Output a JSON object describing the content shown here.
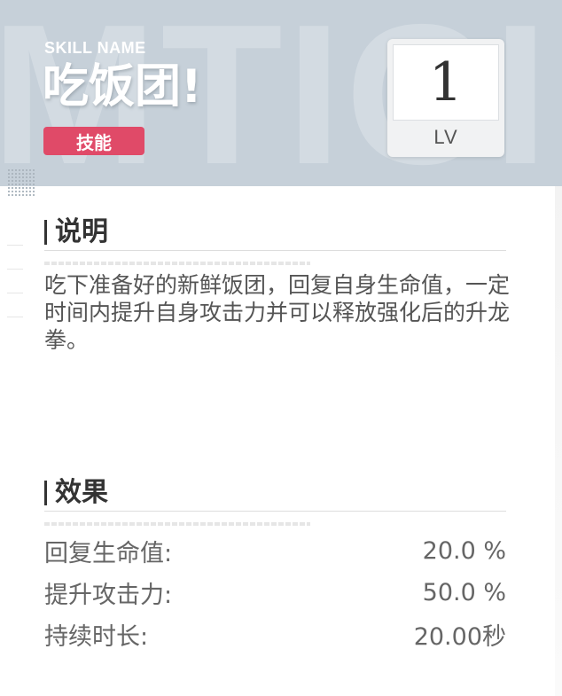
{
  "header": {
    "watermark": "MTICII",
    "skill_label": "SKILL NAME",
    "title": "吃饭团!",
    "tag": "技能",
    "level_number": "1",
    "level_label": "LV"
  },
  "sections": {
    "description": {
      "title": "说明",
      "text": "吃下准备好的新鲜饭团，回复自身生命值，一定时间内提升自身攻击力并可以释放强化后的升龙拳。"
    },
    "effects": {
      "title": "效果",
      "rows": [
        {
          "label": "回复生命值:",
          "value": "20.0 %"
        },
        {
          "label": "提升攻击力:",
          "value": "50.0 %"
        },
        {
          "label": "持续时长:",
          "value": "20.00秒"
        }
      ]
    }
  },
  "colors": {
    "header_bg": "#c6d0d9",
    "tag_bg": "#e04a68"
  }
}
